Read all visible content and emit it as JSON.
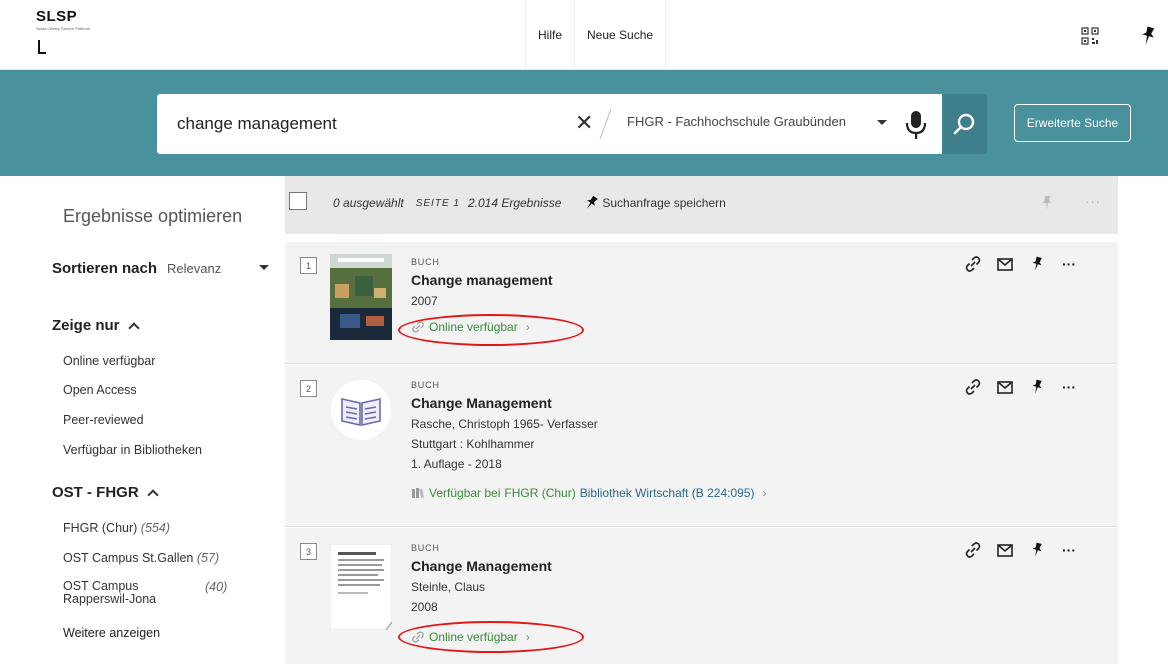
{
  "logo": {
    "main": "SLSP",
    "sub": "Swiss Library Service Platform"
  },
  "nav": {
    "items": [
      "Hilfe",
      "Neue Suche"
    ]
  },
  "search": {
    "query": "change management",
    "scope": "FHGR - Fachhochschule Graubünden",
    "advanced_label": "Erweiterte Suche"
  },
  "sidebar": {
    "title": "Ergebnisse optimieren",
    "sort_label": "Sortieren nach",
    "sort_value": "Relevanz",
    "facet1_title": "Zeige nur",
    "facet1_items": [
      "Online verfügbar",
      "Open Access",
      "Peer-reviewed",
      "Verfügbar in Bibliotheken"
    ],
    "facet2_title": "OST - FHGR",
    "facet2_items": [
      {
        "label": "FHGR (Chur)",
        "count": "(554)"
      },
      {
        "label": "OST Campus St.Gallen",
        "count": "(57)"
      },
      {
        "label": "OST Campus Rapperswil-Jona",
        "count": "(40)"
      }
    ],
    "show_more": "Weitere anzeigen"
  },
  "results_header": {
    "selected": "0 ausgewählt",
    "page": "SEITE 1",
    "count": "2.014 Ergebnisse",
    "save_query": "Suchanfrage speichern"
  },
  "results": [
    {
      "num": "1",
      "type": "BUCH",
      "title": "Change management",
      "lines": [
        "2007"
      ],
      "availability": "Online verfügbar"
    },
    {
      "num": "2",
      "type": "BUCH",
      "title": "Change Management",
      "lines": [
        "Rasche, Christoph 1965- Verfasser",
        "Stuttgart : Kohlhammer",
        "1. Auflage - 2018"
      ],
      "availability_prefix": "Verfügbar bei",
      "availability_loc": "FHGR (Chur)",
      "availability_lib": "Bibliothek Wirtschaft (B 224:095)"
    },
    {
      "num": "3",
      "type": "BUCH",
      "title": "Change Management",
      "lines": [
        "Steinle, Claus",
        "2008"
      ],
      "availability": "Online verfügbar"
    }
  ],
  "colors": {
    "band": "#4a919e",
    "online": "#3a8a3a",
    "highlight": "#e01818"
  }
}
